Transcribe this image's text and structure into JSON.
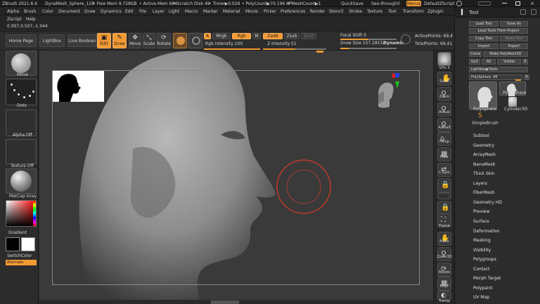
{
  "titlebar": {
    "app": "ZBrush 2021.6.6",
    "project": "DynaMesh_Sphere_128",
    "free_mem": "• Free Mem 9.728GB",
    "active_mem": "• Active Mem 684",
    "scratch": "• Scratch Disk 49",
    "timer": "• Timer▶0.026",
    "polycount": "• PolyCount▶70.196 KP",
    "meshcount": "• MeshCount▶1",
    "quicksave": "QuickSave",
    "see_through": "See-through",
    "see_through_val": "0",
    "menus": "Menus",
    "default_script": "DefaultZScript"
  },
  "menubar": [
    "Alpha",
    "Brush",
    "Color",
    "Document",
    "Draw",
    "Dynamics",
    "Edit",
    "File",
    "Layer",
    "Light",
    "Macro",
    "Marker",
    "Material",
    "Movie",
    "Picker",
    "Preferences",
    "Render",
    "Stencil",
    "Stroke",
    "Texture",
    "Tool",
    "Transform",
    "Zplugin"
  ],
  "menubar2": [
    "Zscript",
    "Help"
  ],
  "coords": "0.007,0.507,-1.344",
  "shelf": {
    "home": "Home Page",
    "lightbox": "LightBox",
    "liveboolean": "Live Boolean",
    "edit": "Edit",
    "draw": "Draw",
    "move": "Move",
    "scale": "Scale",
    "rotate": "Rotate",
    "a": "A",
    "mrgb": "Mrgb",
    "rgb": "Rgb",
    "m": "M",
    "zadd": "Zadd",
    "zsub": "Zsub",
    "zcut": "Zcut",
    "rgb_intensity": "Rgb Intensity 100",
    "z_intensity": "Z Intensity 51",
    "focal_shift": "Focal Shift 0",
    "draw_size": "Draw Size 157.28152",
    "dynamic": "Dynamic",
    "active_points": "ActivePoints: 69,4",
    "total_points": "TotalPoints: 69,41"
  },
  "left": {
    "move": "Move",
    "dots": "Dots",
    "alpha_off": "Alpha Off",
    "texture_off": "Texture Off",
    "matcap": "MatCap Gray",
    "gradient": "Gradient",
    "switchcolor": "SwitchColor",
    "alternate": "Alternate"
  },
  "righttools": {
    "bpr": "BPR",
    "spix": "SPix 3",
    "scroll": "Scroll",
    "zoom": "Zoom",
    "actual": "Actual",
    "aahalf": "AAHalf",
    "persp": "Persp",
    "floor": "Floor",
    "lsym": "L.Sym",
    "xyz": "Qxyz",
    "frame": "Frame",
    "move": "Move",
    "zoom3d": "Zoom3D",
    "rotate": "Rotate",
    "polyf": "PolyF",
    "transp": "Transp"
  },
  "toolpanel": {
    "title": "Tool",
    "load_tool": "Load Tool",
    "save_as": "Save As",
    "load_from_project": "Load Tools From Project",
    "copy_tool": "Copy Tool",
    "paste_tool": "Paste Tool",
    "import": "Import",
    "export": "Export",
    "clone": "Clone",
    "make_polymesh": "Make PolyMesh3D",
    "goz": "GoZ",
    "all": "All",
    "visible": "Visible",
    "r": "R",
    "lightbox_tools": "Lightbox▶Tools",
    "polysphere": "PolySphere. 48",
    "r2": "R",
    "thumb1": "PolySphere",
    "thumb2": "PolySphere",
    "thumb3": "Cylinder3D",
    "thumb4": "SimpleBrush",
    "items": [
      "Subtool",
      "Geometry",
      "ArrayMesh",
      "NanoMesh",
      "Thick Skin",
      "Layers",
      "FiberMesh",
      "Geometry HD",
      "Preview",
      "Surface",
      "Deformation",
      "Masking",
      "Visibility",
      "Polygroups",
      "Contact",
      "Morph Target",
      "Polypaint",
      "UV Map"
    ]
  }
}
